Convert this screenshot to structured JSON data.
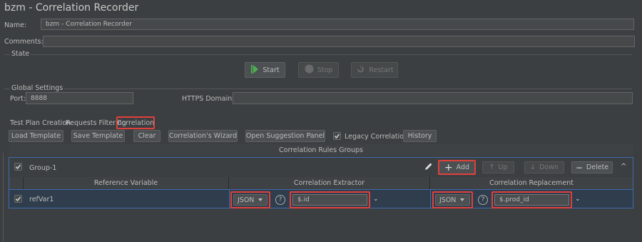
{
  "window": {
    "title": "bzm - Correlation Recorder"
  },
  "form": {
    "name_label": "Name:",
    "name_value": "bzm - Correlation Recorder",
    "comments_label": "Comments:",
    "comments_value": ""
  },
  "state": {
    "heading": "State",
    "start_label": "Start",
    "stop_label": "Stop",
    "restart_label": "Restart"
  },
  "global_settings": {
    "heading": "Global Settings",
    "port_label": "Port:",
    "port_value": "8888",
    "https_label": "HTTPS Domains:",
    "https_value": ""
  },
  "tabs": [
    {
      "label": "Test Plan Creation"
    },
    {
      "label": "Requests Filtering"
    },
    {
      "label": "Correlation",
      "selected": true
    }
  ],
  "toolbar": {
    "load_template": "Load Template",
    "save_template": "Save Template",
    "clear": "Clear",
    "wizard": "Correlation's Wizard",
    "suggestion": "Open Suggestion Panel",
    "legacy_label": "Legacy Correlation",
    "legacy_checked": true,
    "history": "History"
  },
  "rules": {
    "heading": "Correlation Rules Groups",
    "group": {
      "name": "Group-1",
      "enabled": true,
      "add": "Add",
      "up": "Up",
      "down": "Down",
      "delete": "Delete"
    },
    "columns": [
      "Reference Variable",
      "Correlation Extractor",
      "Correlation Replacement"
    ],
    "row": {
      "enabled": true,
      "reference": "refVar1",
      "extractor_type": "JSON",
      "extractor_value": "$.id",
      "replacement_type": "JSON",
      "replacement_value": "$.prod_id"
    }
  },
  "colors": {
    "background": "#3c3f41",
    "highlight": "#e0403c",
    "accent": "#3e6bb0",
    "start_icon": "#4caf50"
  }
}
